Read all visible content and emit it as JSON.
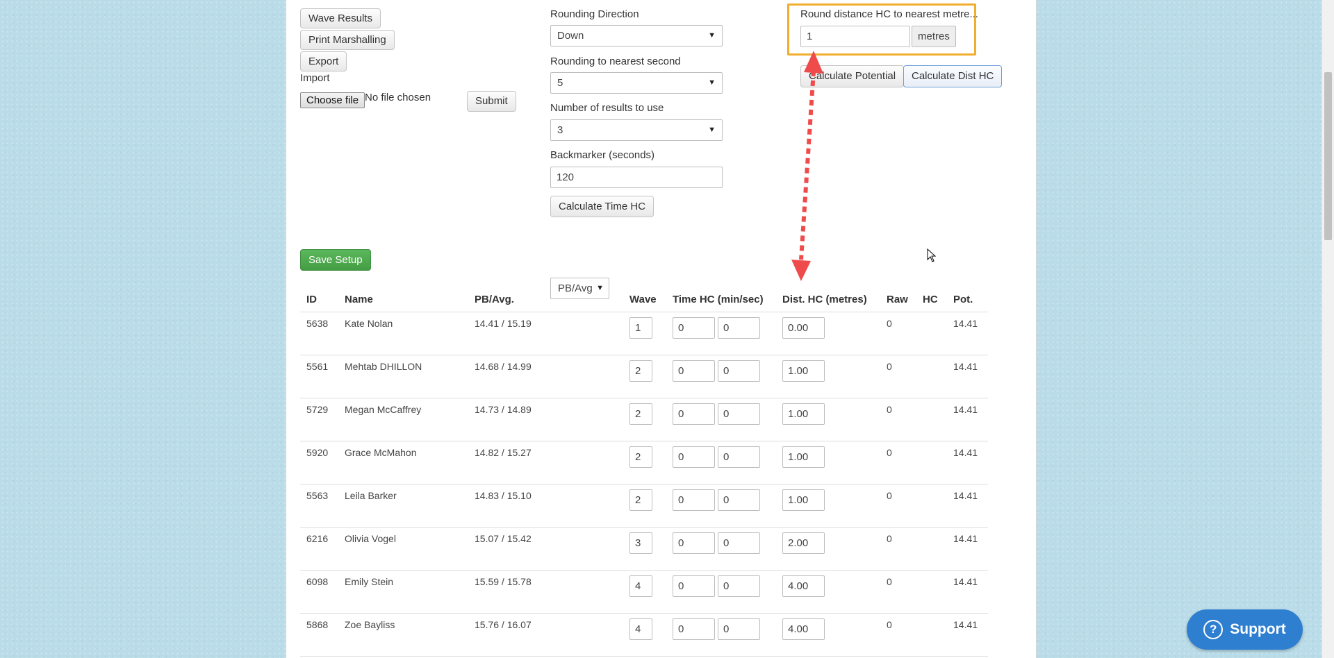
{
  "left_controls": {
    "wave_results": "Wave Results",
    "print_marshalling": "Print Marshalling",
    "export": "Export",
    "import_label": "Import",
    "choose_file": "Choose file",
    "no_file": "No file chosen",
    "submit": "Submit"
  },
  "middle_controls": {
    "rounding_direction_label": "Rounding Direction",
    "rounding_direction_value": "Down",
    "rounding_second_label": "Rounding to nearest second",
    "rounding_second_value": "5",
    "num_results_label": "Number of results to use",
    "num_results_value": "3",
    "backmarker_label": "Backmarker (seconds)",
    "backmarker_value": "120",
    "calc_time_hc": "Calculate Time HC"
  },
  "right_controls": {
    "round_dist_label": "Round distance HC to nearest metre...",
    "round_dist_value": "1",
    "unit": "metres",
    "calc_potential": "Calculate Potential",
    "calc_dist_hc": "Calculate Dist HC"
  },
  "save_setup": "Save Setup",
  "pb_select": "PB/Avg",
  "table": {
    "headers": [
      "ID",
      "Name",
      "PB/Avg.",
      "Wave",
      "Time HC (min/sec)",
      "Dist. HC (metres)",
      "Raw",
      "HC",
      "Pot."
    ],
    "rows": [
      {
        "id": "5638",
        "name": "Kate Nolan",
        "pb": "14.41 / 15.19",
        "wave": "1",
        "min": "0",
        "sec": "0",
        "dist": "0.00",
        "raw": "0",
        "hc": "",
        "pot": "14.41"
      },
      {
        "id": "5561",
        "name": "Mehtab DHILLON",
        "pb": "14.68 / 14.99",
        "wave": "2",
        "min": "0",
        "sec": "0",
        "dist": "1.00",
        "raw": "0",
        "hc": "",
        "pot": "14.41"
      },
      {
        "id": "5729",
        "name": "Megan McCaffrey",
        "pb": "14.73 / 14.89",
        "wave": "2",
        "min": "0",
        "sec": "0",
        "dist": "1.00",
        "raw": "0",
        "hc": "",
        "pot": "14.41"
      },
      {
        "id": "5920",
        "name": "Grace McMahon",
        "pb": "14.82 / 15.27",
        "wave": "2",
        "min": "0",
        "sec": "0",
        "dist": "1.00",
        "raw": "0",
        "hc": "",
        "pot": "14.41"
      },
      {
        "id": "5563",
        "name": "Leila Barker",
        "pb": "14.83 / 15.10",
        "wave": "2",
        "min": "0",
        "sec": "0",
        "dist": "1.00",
        "raw": "0",
        "hc": "",
        "pot": "14.41"
      },
      {
        "id": "6216",
        "name": "Olivia Vogel",
        "pb": "15.07 / 15.42",
        "wave": "3",
        "min": "0",
        "sec": "0",
        "dist": "2.00",
        "raw": "0",
        "hc": "",
        "pot": "14.41"
      },
      {
        "id": "6098",
        "name": "Emily Stein",
        "pb": "15.59 / 15.78",
        "wave": "4",
        "min": "0",
        "sec": "0",
        "dist": "4.00",
        "raw": "0",
        "hc": "",
        "pot": "14.41"
      },
      {
        "id": "5868",
        "name": "Zoe Bayliss",
        "pb": "15.76 / 16.07",
        "wave": "4",
        "min": "0",
        "sec": "0",
        "dist": "4.00",
        "raw": "0",
        "hc": "",
        "pot": "14.41"
      }
    ]
  },
  "support": "Support",
  "colors": {
    "highlight": "#f0ad2e",
    "arrow": "#f04b4b",
    "save_green": "#5cb85c",
    "support_blue": "#2f7fd1"
  }
}
